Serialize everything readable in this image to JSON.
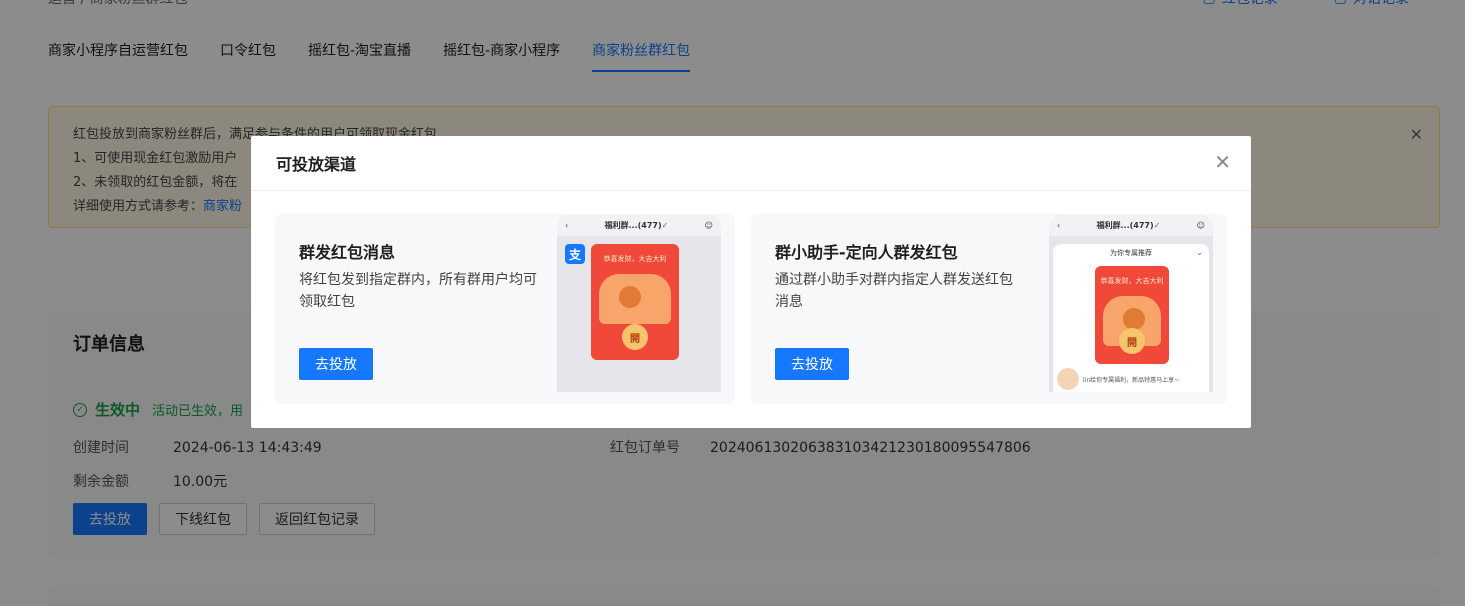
{
  "top": {
    "breadcrumb": "运营 / 商家粉丝群红包",
    "links": [
      "红包记录",
      "对话记录"
    ]
  },
  "tabs": [
    {
      "label": "商家小程序自运营红包",
      "active": false
    },
    {
      "label": "口令红包",
      "active": false
    },
    {
      "label": "摇红包-淘宝直播",
      "active": false
    },
    {
      "label": "摇红包-商家小程序",
      "active": false
    },
    {
      "label": "商家粉丝群红包",
      "active": true
    }
  ],
  "notice": {
    "line1": "红包投放到商家粉丝群后，满足参与条件的用户可领取现金红包",
    "line2": "1、可使用现金红包激励用户",
    "line3": "2、未领取的红包金额，将在",
    "line4_prefix": "详细使用方式请参考：",
    "line4_link": "商家粉"
  },
  "order": {
    "title": "订单信息",
    "status": "生效中",
    "status_desc": "活动已生效，用",
    "created_label": "创建时间",
    "created_value": "2024-06-13 14:43:49",
    "order_no_label": "红包订单号",
    "order_no_value": "2024061302063831034212301800955478​06",
    "remain_label": "剩余金额",
    "remain_value": "10.00元",
    "buttons": {
      "deliver": "去投放",
      "offline": "下线红包",
      "back": "返回红包记录"
    }
  },
  "modal": {
    "title": "可投放渠道",
    "channels": [
      {
        "title": "群发红包消息",
        "desc": "将红包发到指定群内，所有群用户均可领取红包",
        "button": "去投放",
        "phone_title": "福利群...(477)",
        "alipay": "支",
        "envelope_text": "恭喜发财，大吉大利",
        "open": "開"
      },
      {
        "title": "群小助手-定向人群发红包",
        "desc": "通过群小助手对群内指定人群发送红包消息",
        "button": "去投放",
        "phone_title": "福利群...(477)",
        "rec_head": "为你专属推荐",
        "envelope_text": "恭喜发财，大吉大利",
        "open": "開",
        "footer": "lin给你专属福利，新品特惠马上享~"
      }
    ]
  },
  "colors": {
    "accent": "#1677ff",
    "success": "#16a34a",
    "envelope": "#f0493a"
  }
}
